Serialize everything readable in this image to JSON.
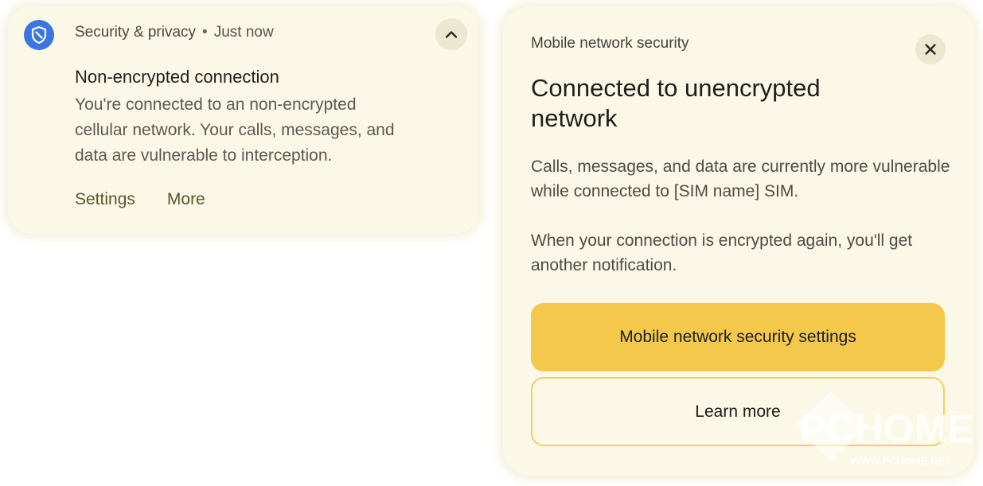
{
  "notification": {
    "app_name": "Security & privacy",
    "separator": "•",
    "timestamp": "Just now",
    "title": "Non-encrypted connection",
    "body": "You're connected to an non-encrypted cellular network. Your calls, messages, and data are vulnerable to interception.",
    "actions": [
      "Settings",
      "More"
    ],
    "icons": {
      "app": "shield-icon",
      "collapse": "chevron-up-icon"
    }
  },
  "dialog": {
    "subtitle": "Mobile network security",
    "headline": "Connected to unencrypted network",
    "paragraph1": "Calls, messages, and data are currently more vulnerable while connected to [SIM name] SIM.",
    "paragraph2": "When your connection is encrypted again, you'll get another notification.",
    "primary_button": "Mobile network security settings",
    "secondary_button": "Learn more",
    "icons": {
      "close": "close-icon"
    }
  },
  "watermark": {
    "brand": "PCHOME",
    "url": "WWW.PCHOME.NET"
  },
  "colors": {
    "card_background": "#fbf8e7",
    "app_icon": "#3b76e0",
    "primary_button": "#f4c84b",
    "secondary_border": "#f0cf64",
    "action_text": "#58572c"
  }
}
